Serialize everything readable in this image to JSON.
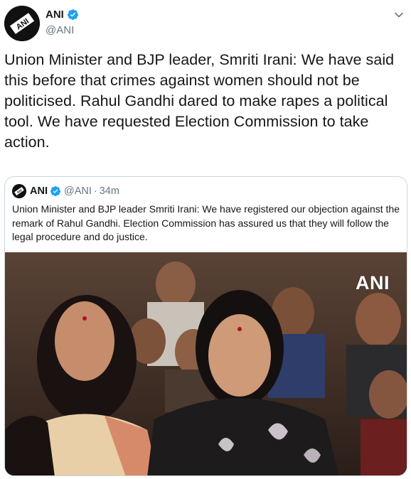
{
  "tweet": {
    "author": {
      "name": "ANI",
      "handle": "@ANI",
      "verified": true,
      "avatar_icon": "ani-logo-icon"
    },
    "text": "Union Minister and BJP leader, Smriti Irani: We have said this before that crimes against women should not be politicised. Rahul Gandhi dared to make rapes a political tool. We have requested Election Commission to take action.",
    "menu_icon": "chevron-down-icon"
  },
  "quoted_tweet": {
    "author": {
      "name": "ANI",
      "handle": "@ANI",
      "verified": true,
      "avatar_icon": "ani-logo-icon"
    },
    "separator": "·",
    "time": "34m",
    "text": "Union Minister and BJP leader Smriti Irani: We have registered our objection against the remark of Rahul Gandhi. Election Commission has assured us that they will follow the legal procedure and do justice.",
    "media": {
      "kind": "photo",
      "watermark": "ANI"
    }
  },
  "colors": {
    "verified": "#1da1f2",
    "secondary_text": "#657786",
    "border": "#ccd6dd"
  }
}
